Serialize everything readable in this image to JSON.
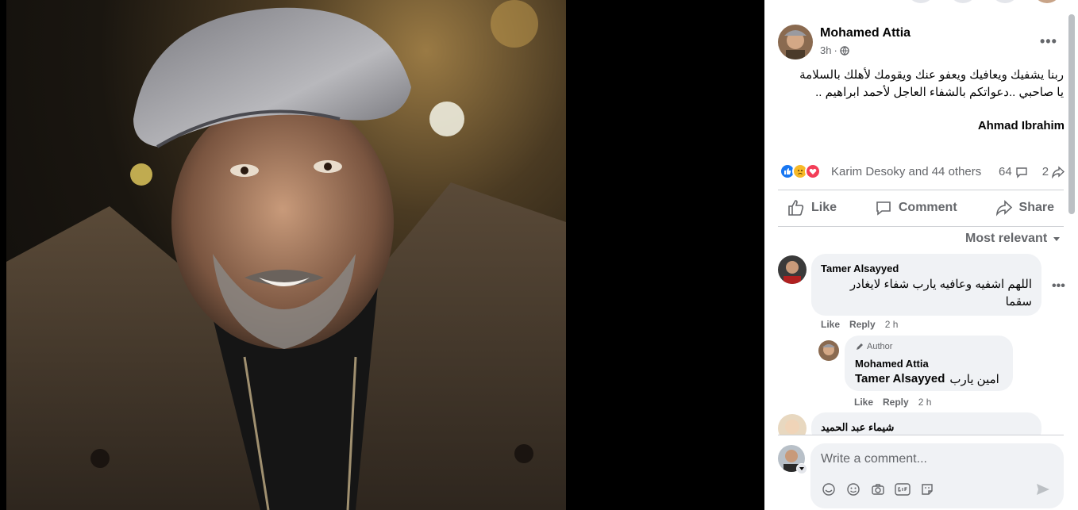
{
  "post": {
    "author": "Mohamed Attia",
    "time": "3h",
    "text": "ربنا يشفيك ويعافيك ويعفو عنك ويقومك لأهلك بالسلامة يا صاحبي ..دعواتكم بالشفاء العاجل لأحمد ابراهيم ..",
    "mention": "Ahmad Ibrahim",
    "reactions_text": "Karim Desoky and 44 others",
    "comments_count": "64",
    "shares_count": "2",
    "colors": {
      "like": "#1877f2",
      "sad": "#f7b928",
      "love": "#f33e58"
    }
  },
  "actions": {
    "like": "Like",
    "comment": "Comment",
    "share": "Share"
  },
  "sort_label": "Most relevant",
  "comments": [
    {
      "author": "Tamer Alsayyed",
      "text": "اللهم اشفيه وعافيه يارب شفاء لايغادر سقما",
      "like": "Like",
      "reply": "Reply",
      "time": "2 h"
    },
    {
      "badge": "Author",
      "author": "Mohamed Attia",
      "mention": "Tamer Alsayyed",
      "text": "امين يارب",
      "like": "Like",
      "reply": "Reply",
      "time": "2 h"
    },
    {
      "author": "شيماء عبد الحميد"
    }
  ],
  "composer": {
    "placeholder": "Write a comment..."
  }
}
